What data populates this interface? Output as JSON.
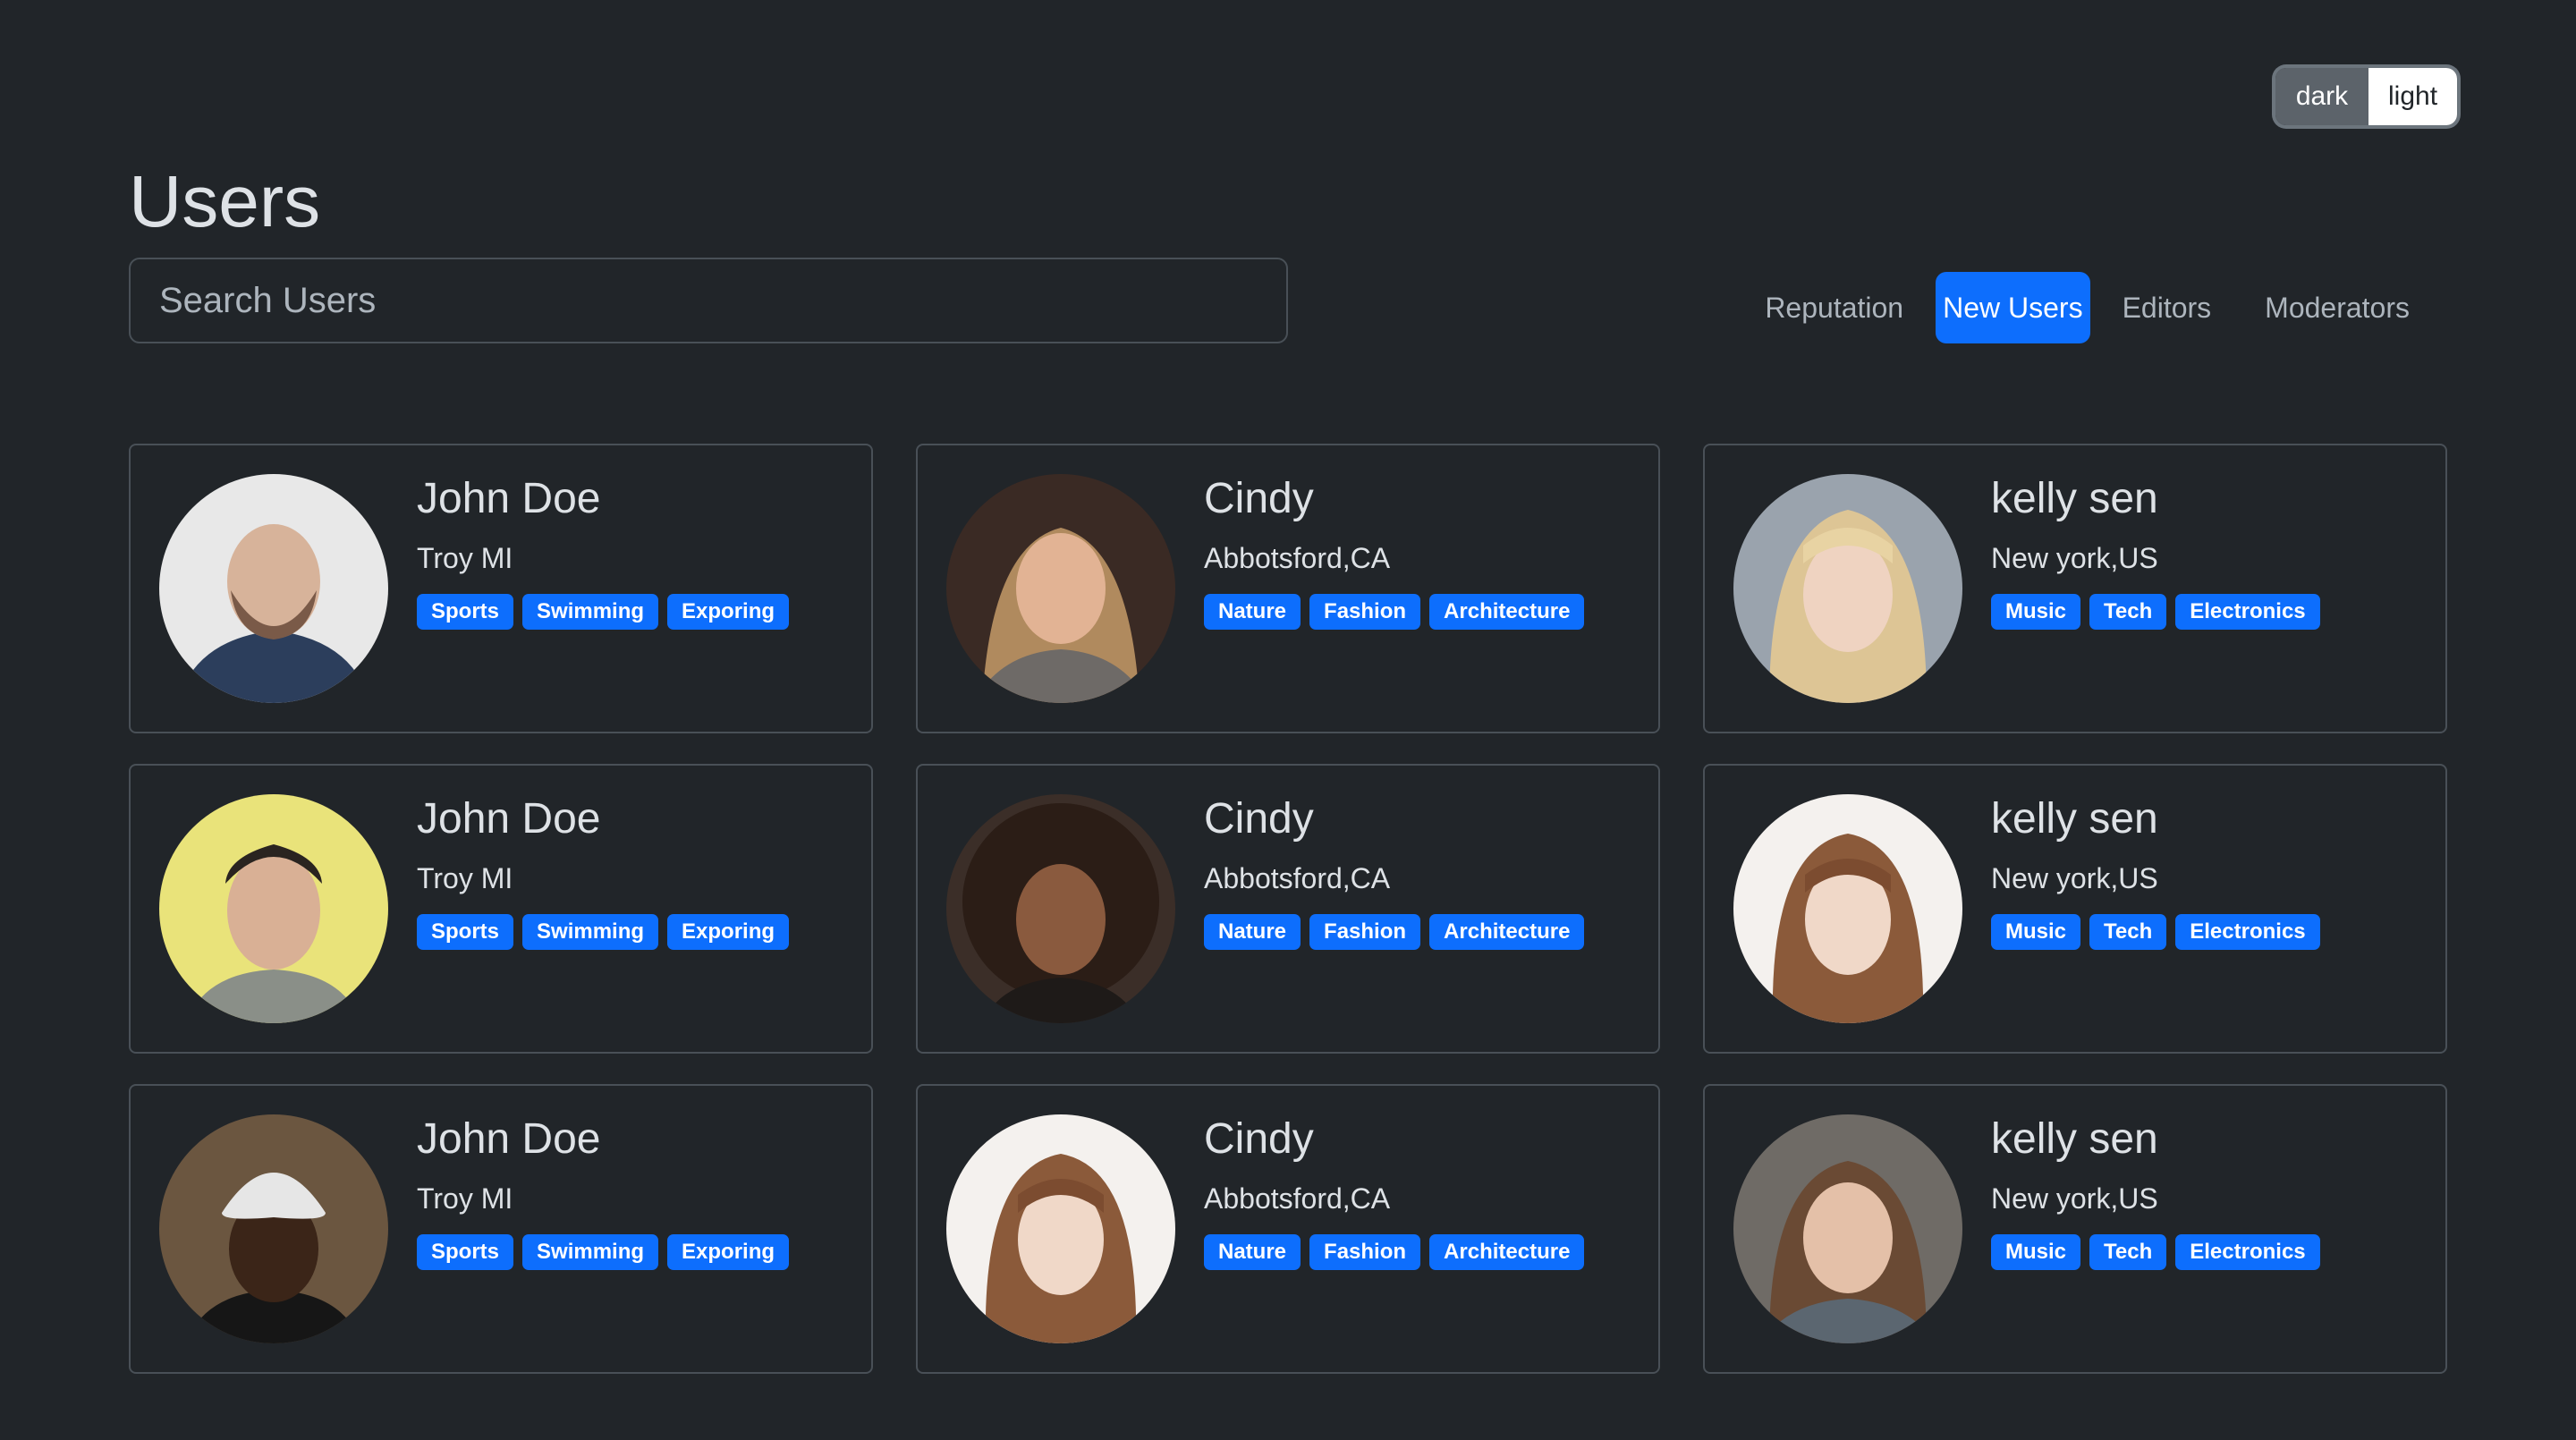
{
  "theme": {
    "dark_label": "dark",
    "light_label": "light"
  },
  "title": "Users",
  "search": {
    "placeholder": "Search Users"
  },
  "tabs": [
    {
      "label": "Reputation",
      "active": false
    },
    {
      "label": "New Users",
      "active": true
    },
    {
      "label": "Editors",
      "active": false
    },
    {
      "label": "Moderators",
      "active": false
    }
  ],
  "users": [
    {
      "name": "John Doe",
      "location": "Troy MI",
      "tags": [
        "Sports",
        "Swimming",
        "Exporing"
      ]
    },
    {
      "name": "Cindy",
      "location": "Abbotsford,CA",
      "tags": [
        "Nature",
        "Fashion",
        "Architecture"
      ]
    },
    {
      "name": "kelly sen",
      "location": "New york,US",
      "tags": [
        "Music",
        "Tech",
        "Electronics"
      ]
    },
    {
      "name": "John Doe",
      "location": "Troy MI",
      "tags": [
        "Sports",
        "Swimming",
        "Exporing"
      ]
    },
    {
      "name": "Cindy",
      "location": "Abbotsford,CA",
      "tags": [
        "Nature",
        "Fashion",
        "Architecture"
      ]
    },
    {
      "name": "kelly sen",
      "location": "New york,US",
      "tags": [
        "Music",
        "Tech",
        "Electronics"
      ]
    },
    {
      "name": "John Doe",
      "location": "Troy MI",
      "tags": [
        "Sports",
        "Swimming",
        "Exporing"
      ]
    },
    {
      "name": "Cindy",
      "location": "Abbotsford,CA",
      "tags": [
        "Nature",
        "Fashion",
        "Architecture"
      ]
    },
    {
      "name": "kelly sen",
      "location": "New york,US",
      "tags": [
        "Music",
        "Tech",
        "Electronics"
      ]
    }
  ],
  "colors": {
    "background": "#212529",
    "accent": "#0d6efd",
    "border": "#495057"
  }
}
